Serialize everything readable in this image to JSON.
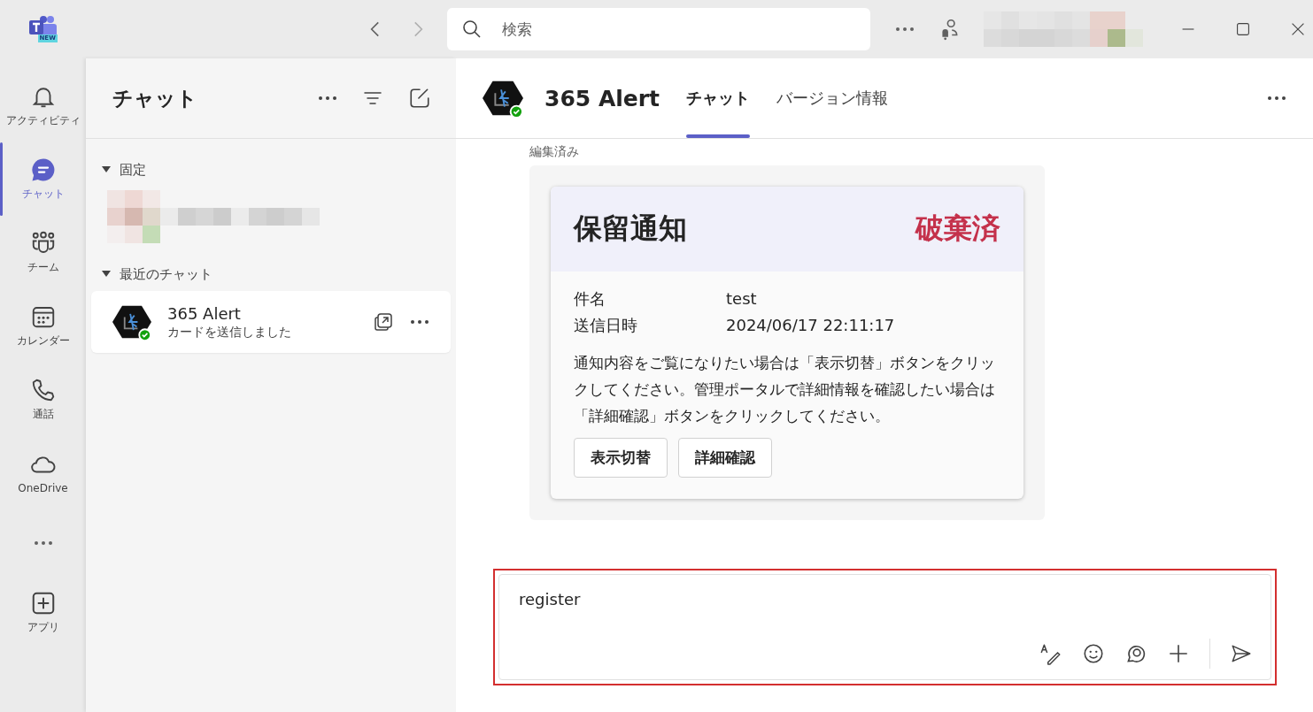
{
  "titlebar": {
    "search": {
      "placeholder": "検索"
    },
    "badge": "NEW"
  },
  "rail": [
    {
      "label": "アクティビティ",
      "selected": false
    },
    {
      "label": "チャット",
      "selected": true
    },
    {
      "label": "チーム",
      "selected": false
    },
    {
      "label": "カレンダー",
      "selected": false
    },
    {
      "label": "通話",
      "selected": false
    },
    {
      "label": "OneDrive",
      "selected": false
    },
    {
      "label": "アプリ",
      "selected": false
    }
  ],
  "chat_list": {
    "title": "チャット",
    "sections": [
      {
        "label": "固定",
        "expanded": true
      },
      {
        "label": "最近のチャット",
        "expanded": true,
        "items": [
          {
            "name": "365 Alert",
            "preview": "カードを送信しました",
            "selected": true
          }
        ]
      }
    ]
  },
  "conversation": {
    "name": "365 Alert",
    "tabs": [
      {
        "label": "チャット",
        "selected": true
      },
      {
        "label": "バージョン情報",
        "selected": false
      }
    ],
    "edited": "編集済み",
    "card": {
      "title": "保留通知",
      "status": "破棄済",
      "facts": [
        {
          "label": "件名",
          "value": "test"
        },
        {
          "label": "送信日時",
          "value": "2024/06/17 22:11:17"
        }
      ],
      "body": "通知内容をご覧になりたい場合は「表示切替」ボタンをクリックしてください。管理ポータルで詳細情報を確認したい場合は「詳細確認」ボタンをクリックしてください。",
      "buttons": [
        "表示切替",
        "詳細確認"
      ]
    }
  },
  "composer": {
    "value": "register",
    "highlighted": true
  }
}
